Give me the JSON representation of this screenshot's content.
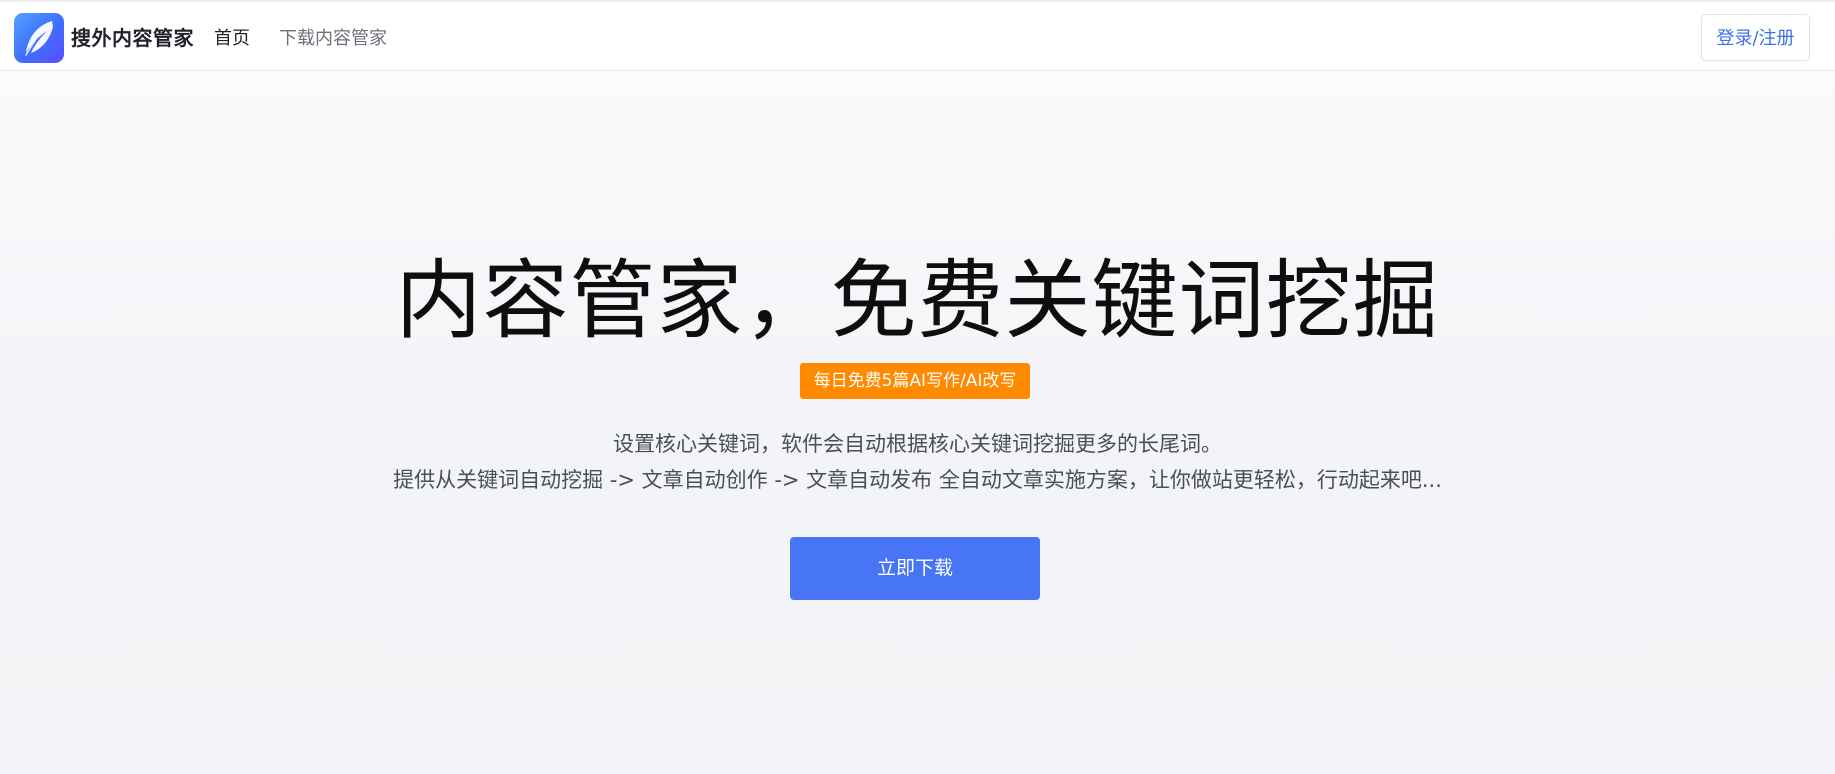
{
  "header": {
    "brand_name": "搜外内容管家",
    "nav": [
      {
        "label": "首页"
      },
      {
        "label": "下载内容管家"
      }
    ],
    "login_label": "登录/注册"
  },
  "hero": {
    "title": "内容管家，免费关键词挖掘",
    "badge": "每日免费5篇AI写作/AI改写",
    "description_line1": "设置核心关键词，软件会自动根据核心关键词挖掘更多的长尾词。",
    "description_line2": "提供从关键词自动挖掘 -> 文章自动创作 -> 文章自动发布 全自动文章实施方案，让你做站更轻松，行动起来吧...",
    "download_label": "立即下载"
  },
  "colors": {
    "accent": "#4775f5",
    "badge": "#ff8a00",
    "link": "#3b73e8"
  },
  "icons": {
    "logo": "feather-icon"
  }
}
